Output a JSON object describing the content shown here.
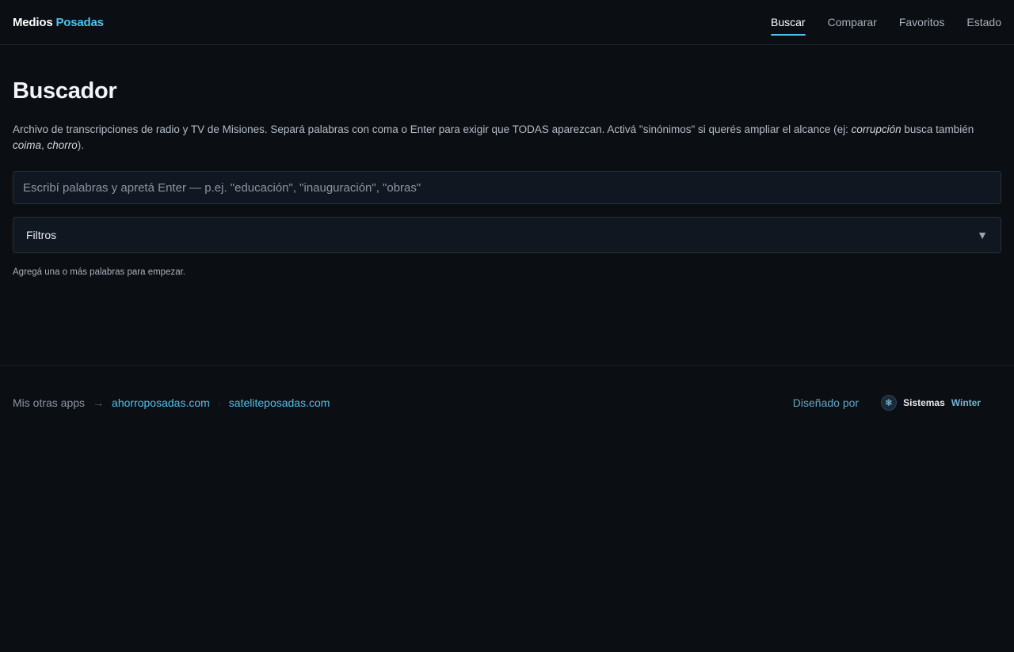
{
  "brand": {
    "part1": "Medios",
    "part2": "Posadas"
  },
  "nav": [
    {
      "label": "Buscar",
      "active": true
    },
    {
      "label": "Comparar",
      "active": false
    },
    {
      "label": "Favoritos",
      "active": false
    },
    {
      "label": "Estado",
      "active": false
    }
  ],
  "page": {
    "title": "Buscador",
    "description": {
      "part1": "Archivo de transcripciones de radio y TV de Misiones. Separá palabras con coma o Enter para exigir que TODAS aparezcan. Activá \"sinónimos\" si querés ampliar el alcance (ej: ",
      "em1": "corrupción",
      "part2": " busca también ",
      "em2": "coima",
      "part3": ", ",
      "em3": "chorro",
      "part4": ")."
    }
  },
  "search": {
    "value": "",
    "placeholder": "Escribí palabras y apretá Enter — p.ej. \"educación\", \"inauguración\", \"obras\""
  },
  "filters": {
    "label": "Filtros",
    "caret": "▼"
  },
  "hint": "Agregá una o más palabras para empezar.",
  "footer": {
    "other_apps_label": "Mis otras apps",
    "arrow": "→",
    "links": [
      "ahorroposadas.com",
      "sateliteposadas.com"
    ],
    "separator": "·",
    "designed_by": "Diseñado por",
    "maker": {
      "part1": "Sistemas",
      "part2": "Winter",
      "icon": "snowflake-icon"
    }
  },
  "colors": {
    "background": "#0b0e13",
    "accent": "#4cc2ea",
    "panel": "#111720",
    "border": "#27303b"
  }
}
